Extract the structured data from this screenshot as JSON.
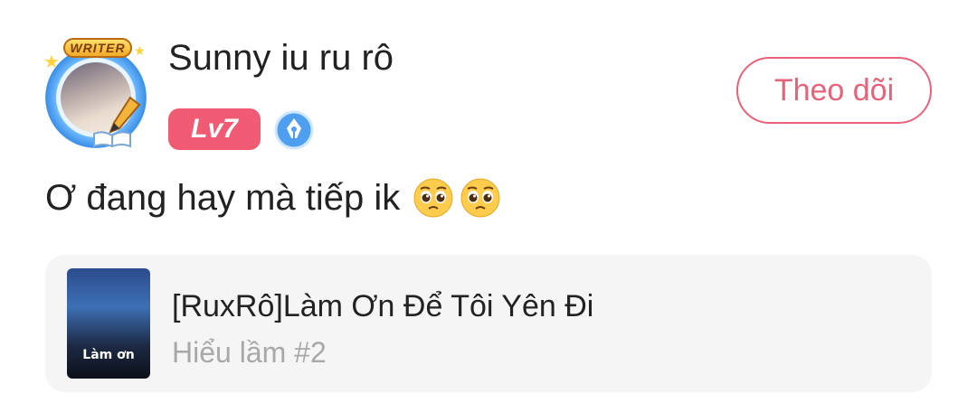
{
  "user": {
    "name": "Sunny iu ru rô",
    "writer_badge": "WRITER",
    "level": "Lv7"
  },
  "follow_button": {
    "label": "Theo dõi"
  },
  "comment": {
    "text": "Ơ đang hay mà tiếp ik",
    "emojis": [
      "pleading-face-emoji",
      "pleading-face-emoji"
    ]
  },
  "story": {
    "title": "[RuxRô]Làm Ơn Để Tôi Yên Đi",
    "chapter": "Hiểu lầm #2",
    "thumb_caption": "Làm ơn"
  },
  "colors": {
    "accent": "#e8627a",
    "level_badge": "#f05a72",
    "card_bg": "#f5f5f5",
    "muted_text": "#a8a8a8"
  }
}
